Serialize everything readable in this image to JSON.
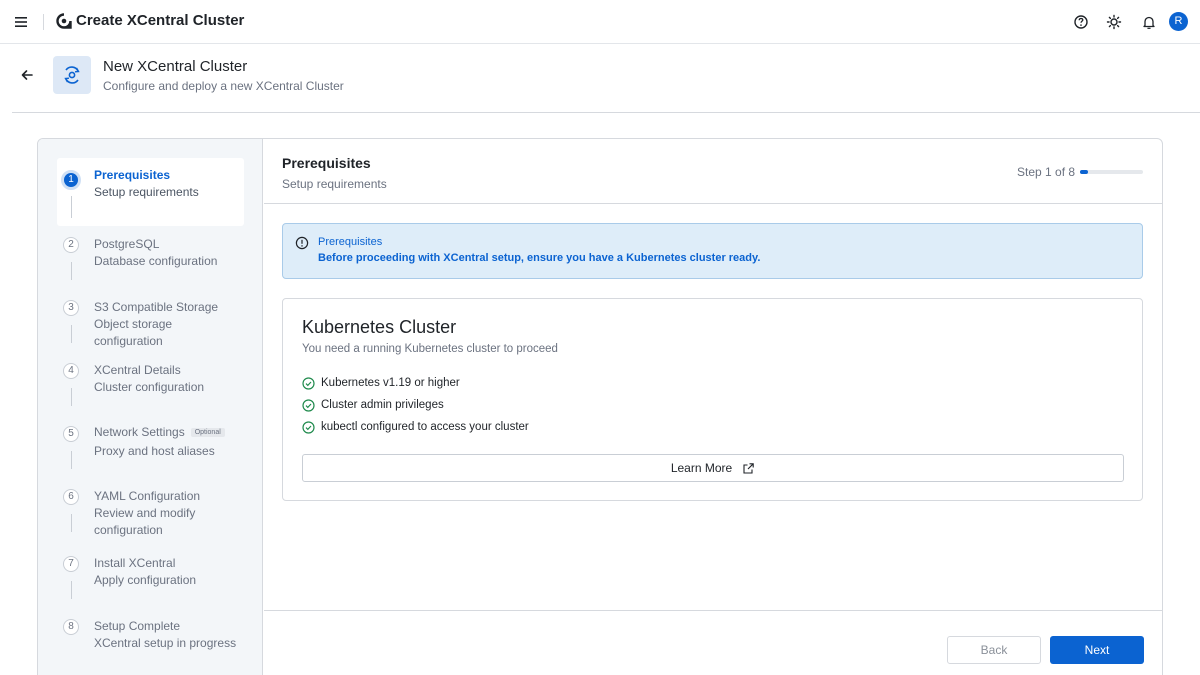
{
  "app": {
    "title": "Create XCentral Cluster",
    "avatar_initial": "R",
    "icons": [
      "menu-icon",
      "app-logo-icon",
      "help-icon",
      "theme-icon",
      "bell-icon"
    ]
  },
  "header": {
    "title": "New XCentral Cluster",
    "subtitle": "Configure and deploy a new XCentral Cluster"
  },
  "steps": [
    {
      "num": "1",
      "title": "Prerequisites",
      "desc": "Setup requirements",
      "tag": "",
      "active": true
    },
    {
      "num": "2",
      "title": "PostgreSQL",
      "desc": "Database configuration",
      "tag": ""
    },
    {
      "num": "3",
      "title": "S3 Compatible Storage",
      "desc": "Object storage configuration",
      "tag": ""
    },
    {
      "num": "4",
      "title": "XCentral Details",
      "desc": "Cluster configuration",
      "tag": ""
    },
    {
      "num": "5",
      "title": "Network Settings",
      "desc": "Proxy and host aliases",
      "tag": "Optional"
    },
    {
      "num": "6",
      "title": "YAML Configuration",
      "desc": "Review and modify configuration",
      "tag": ""
    },
    {
      "num": "7",
      "title": "Install XCentral",
      "desc": "Apply configuration",
      "tag": ""
    },
    {
      "num": "8",
      "title": "Setup Complete",
      "desc": "XCentral setup in progress",
      "tag": ""
    }
  ],
  "content": {
    "title": "Prerequisites",
    "subtitle": "Setup requirements",
    "step_counter": "Step 1 of 8",
    "progress": 0.125,
    "alert": {
      "title": "Prerequisites",
      "text": "Before proceeding with XCentral setup, ensure you have a Kubernetes cluster ready."
    },
    "card": {
      "title": "Kubernetes Cluster",
      "subtitle": "You need a running Kubernetes cluster to proceed",
      "requirements": [
        "Kubernetes v1.19 or higher",
        "Cluster admin privileges",
        "kubectl configured to access your cluster"
      ],
      "learn_more_label": "Learn More"
    }
  },
  "footer": {
    "back_label": "Back",
    "next_label": "Next"
  },
  "colors": {
    "accent": "#0b63d1",
    "alert_bg": "#deedf9",
    "success": "#1f8a4c"
  }
}
